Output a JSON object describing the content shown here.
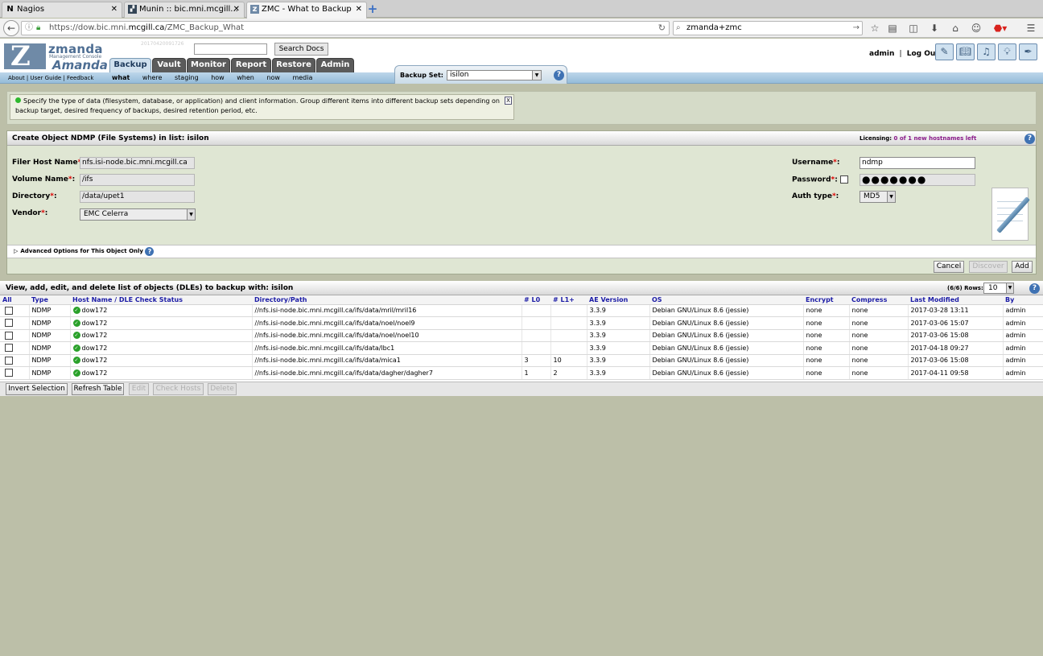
{
  "browser": {
    "tabs": [
      {
        "label": "Nagios",
        "icon": "N"
      },
      {
        "label": "Munin :: bic.mni.mcgill...",
        "icon": "munin"
      },
      {
        "label": "ZMC - What to Backup",
        "icon": "zmc"
      }
    ],
    "url_pre": "https://dow.bic.mni.",
    "url_host": "mcgill.ca",
    "url_post": "/ZMC_Backup_What",
    "search": "zmanda+zmc"
  },
  "header": {
    "logo_name": "zmanda",
    "logo_sub": "Management Console",
    "logo_product": "Amanda",
    "version": "20170420091726",
    "search_docs": "Search Docs",
    "tabs": [
      "Backup",
      "Vault",
      "Monitor",
      "Report",
      "Restore",
      "Admin"
    ],
    "user": "admin",
    "separator": "|",
    "logout": "Log Out",
    "links": "About | User Guide | Feedback",
    "subnav": [
      "what",
      "where",
      "staging",
      "how",
      "when",
      "now",
      "media"
    ],
    "backup_set_label": "Backup Set:",
    "backup_set_value": "isilon"
  },
  "info": {
    "text": "Specify the type of data (filesystem, database, or application) and client information. Group different items into different backup sets depending on backup target, desired frequency of backups, desired retention period, etc.",
    "close": "X"
  },
  "form": {
    "title": "Create Object NDMP (File Systems) in list: isilon",
    "licensing_label": "Licensing:",
    "licensing_value": "0 of 1 new hostnames left",
    "filer_host_label": "Filer Host Name",
    "filer_host_value": "nfs.isi-node.bic.mni.mcgill.ca",
    "volume_label": "Volume Name",
    "volume_value": "/ifs",
    "directory_label": "Directory",
    "directory_value": "/data/upet1",
    "vendor_label": "Vendor",
    "vendor_value": "EMC Celerra",
    "username_label": "Username",
    "username_value": "ndmp",
    "password_label": "Password",
    "password_value": "●●●●●●●",
    "auth_label": "Auth type",
    "auth_value": "MD5",
    "required_mark": "*",
    "colon": ":",
    "advanced": "Advanced Options for This Object Only",
    "cancel": "Cancel",
    "discover": "Discover",
    "add": "Add"
  },
  "list": {
    "title": "View, add, edit, and delete list of objects (DLEs) to backup with: isilon",
    "rows_label": "(6/6) Rows:",
    "rows_value": "10",
    "columns": [
      "All",
      "Type",
      "Host Name / DLE Check Status",
      "Directory/Path",
      "# L0",
      "# L1+",
      "AE Version",
      "OS",
      "Encrypt",
      "Compress",
      "Last Modified",
      "By"
    ],
    "rows": [
      {
        "type": "NDMP",
        "host": "dow172",
        "path": "//nfs.isi-node.bic.mni.mcgill.ca/ifs/data/mril/mril16",
        "l0": "",
        "l1": "",
        "ae": "3.3.9",
        "os": "Debian GNU/Linux 8.6 (jessie)",
        "encrypt": "none",
        "compress": "none",
        "modified": "2017-03-28 13:11",
        "by": "admin"
      },
      {
        "type": "NDMP",
        "host": "dow172",
        "path": "//nfs.isi-node.bic.mni.mcgill.ca/ifs/data/noel/noel9",
        "l0": "",
        "l1": "",
        "ae": "3.3.9",
        "os": "Debian GNU/Linux 8.6 (jessie)",
        "encrypt": "none",
        "compress": "none",
        "modified": "2017-03-06 15:07",
        "by": "admin"
      },
      {
        "type": "NDMP",
        "host": "dow172",
        "path": "//nfs.isi-node.bic.mni.mcgill.ca/ifs/data/noel/noel10",
        "l0": "",
        "l1": "",
        "ae": "3.3.9",
        "os": "Debian GNU/Linux 8.6 (jessie)",
        "encrypt": "none",
        "compress": "none",
        "modified": "2017-03-06 15:08",
        "by": "admin"
      },
      {
        "type": "NDMP",
        "host": "dow172",
        "path": "//nfs.isi-node.bic.mni.mcgill.ca/ifs/data/lbc1",
        "l0": "",
        "l1": "",
        "ae": "3.3.9",
        "os": "Debian GNU/Linux 8.6 (jessie)",
        "encrypt": "none",
        "compress": "none",
        "modified": "2017-04-18 09:27",
        "by": "admin"
      },
      {
        "type": "NDMP",
        "host": "dow172",
        "path": "//nfs.isi-node.bic.mni.mcgill.ca/ifs/data/mica1",
        "l0": "3",
        "l1": "10",
        "ae": "3.3.9",
        "os": "Debian GNU/Linux 8.6 (jessie)",
        "encrypt": "none",
        "compress": "none",
        "modified": "2017-03-06 15:08",
        "by": "admin"
      },
      {
        "type": "NDMP",
        "host": "dow172",
        "path": "//nfs.isi-node.bic.mni.mcgill.ca/ifs/data/dagher/dagher7",
        "l0": "1",
        "l1": "2",
        "ae": "3.3.9",
        "os": "Debian GNU/Linux 8.6 (jessie)",
        "encrypt": "none",
        "compress": "none",
        "modified": "2017-04-11 09:58",
        "by": "admin"
      }
    ],
    "buttons": [
      "Invert Selection",
      "Refresh Table",
      "Edit",
      "Check Hosts",
      "Delete"
    ]
  },
  "colors": {
    "accent": "#3f72b3",
    "tab_bg": "#5b5b5b",
    "page_bg": "#bcbfa8",
    "header_link": "#1c1ca6"
  }
}
